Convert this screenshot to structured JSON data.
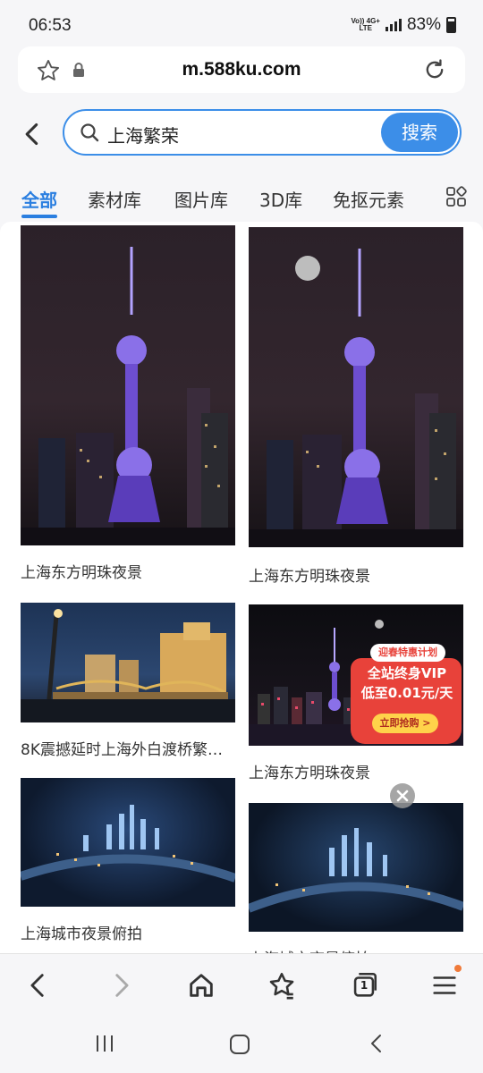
{
  "status": {
    "time": "06:53",
    "network_top": "Vo)) 4G+",
    "network_bottom": "LTE",
    "battery": "83%"
  },
  "browser": {
    "url": "m.588ku.com",
    "tab_count": "1"
  },
  "search": {
    "query": "上海繁荣",
    "button": "搜索"
  },
  "tabs": [
    {
      "label": "全部"
    },
    {
      "label": "素材库"
    },
    {
      "label": "图片库"
    },
    {
      "label": "3D库"
    },
    {
      "label": "免抠元素"
    }
  ],
  "results": [
    {
      "caption": "上海东方明珠夜景"
    },
    {
      "caption": "上海东方明珠夜景"
    },
    {
      "caption": "8K震撼延时上海外白渡桥繁…"
    },
    {
      "caption": "上海东方明珠夜景"
    },
    {
      "caption": "上海城市夜景俯拍"
    },
    {
      "caption": "上海城市夜景俯拍"
    }
  ],
  "promo": {
    "top": "迎春特惠计划",
    "line1": "全站终身VIP",
    "line2": "低至0.01元/天",
    "button": "立即抢购 >"
  },
  "colors": {
    "accent": "#3c8ee8",
    "tab_active": "#2b7fe0",
    "promo_red": "#e8423a"
  }
}
